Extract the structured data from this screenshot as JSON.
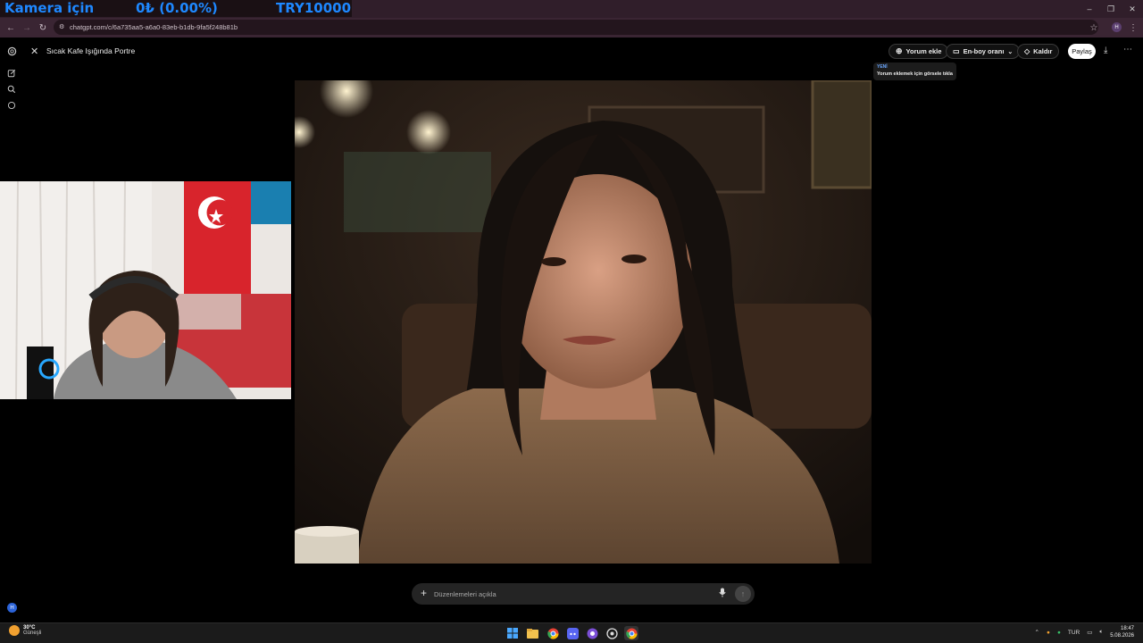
{
  "stream_overlay": {
    "label1": "Kamera için",
    "label2": "0₺ (0.00%)",
    "label3": "TRY10000"
  },
  "browser": {
    "url": "chatgpt.com/c/6a735aa5-a6a0-83eb-b1db-9fa5f248b81b",
    "profile_initial": "H"
  },
  "app": {
    "conversation_title": "Sıcak Kafe Işığında Portre",
    "toolbar": {
      "comment_label": "Yorum ekle",
      "aspect_label": "En-boy oranı",
      "remove_label": "Kaldır",
      "share_label": "Paylaş"
    },
    "tooltip": {
      "badge": "YENİ",
      "text": "Yorum eklemek için görsele tıkla"
    },
    "composer": {
      "placeholder": "Düzenlemeleri açıkla"
    },
    "user_avatar_initial": "H"
  },
  "taskbar": {
    "weather_temp": "30°C",
    "weather_desc": "Güneşli",
    "language": "TUR",
    "time": "18:47",
    "date": "5.08.2026"
  },
  "icons": [
    "chatgpt-logo-icon",
    "new-chat-icon",
    "search-icon",
    "chat-icon",
    "close-icon",
    "comment-icon",
    "aspect-icon",
    "eraser-icon",
    "download-icon",
    "more-icon",
    "plus-icon",
    "mic-icon",
    "send-icon",
    "star-icon"
  ]
}
